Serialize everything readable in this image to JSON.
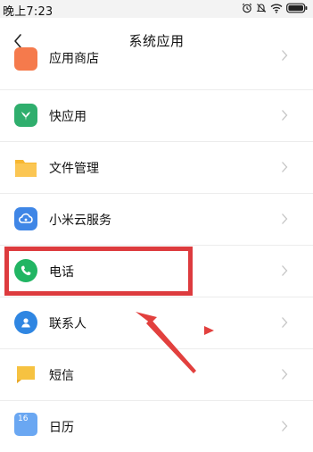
{
  "status_bar": {
    "time": "晚上7:23",
    "icons": [
      "alarm-icon",
      "silent-icon",
      "wifi-icon",
      "battery-icon"
    ]
  },
  "header": {
    "back_icon": "chevron-left-icon",
    "title": "系统应用"
  },
  "list": {
    "items": [
      {
        "label": "应用商店",
        "icon": "app-store-icon",
        "color": "#f57a4c"
      },
      {
        "label": "快应用",
        "icon": "quick-app-icon",
        "color": "#2fae6d"
      },
      {
        "label": "文件管理",
        "icon": "folder-icon",
        "color": "#f7b731"
      },
      {
        "label": "小米云服务",
        "icon": "cloud-icon",
        "color": "#3f86e6"
      },
      {
        "label": "电话",
        "icon": "phone-icon",
        "color": "#21b563"
      },
      {
        "label": "联系人",
        "icon": "contacts-icon",
        "color": "#2f86e2"
      },
      {
        "label": "短信",
        "icon": "sms-icon",
        "color": "#f6c241"
      },
      {
        "label": "日历",
        "icon": "calendar-icon",
        "color": "#6aa7f2",
        "badge": "16"
      }
    ]
  },
  "annotation": {
    "highlight_color": "#dd3b3e",
    "arrow_color": "#e2403e"
  }
}
